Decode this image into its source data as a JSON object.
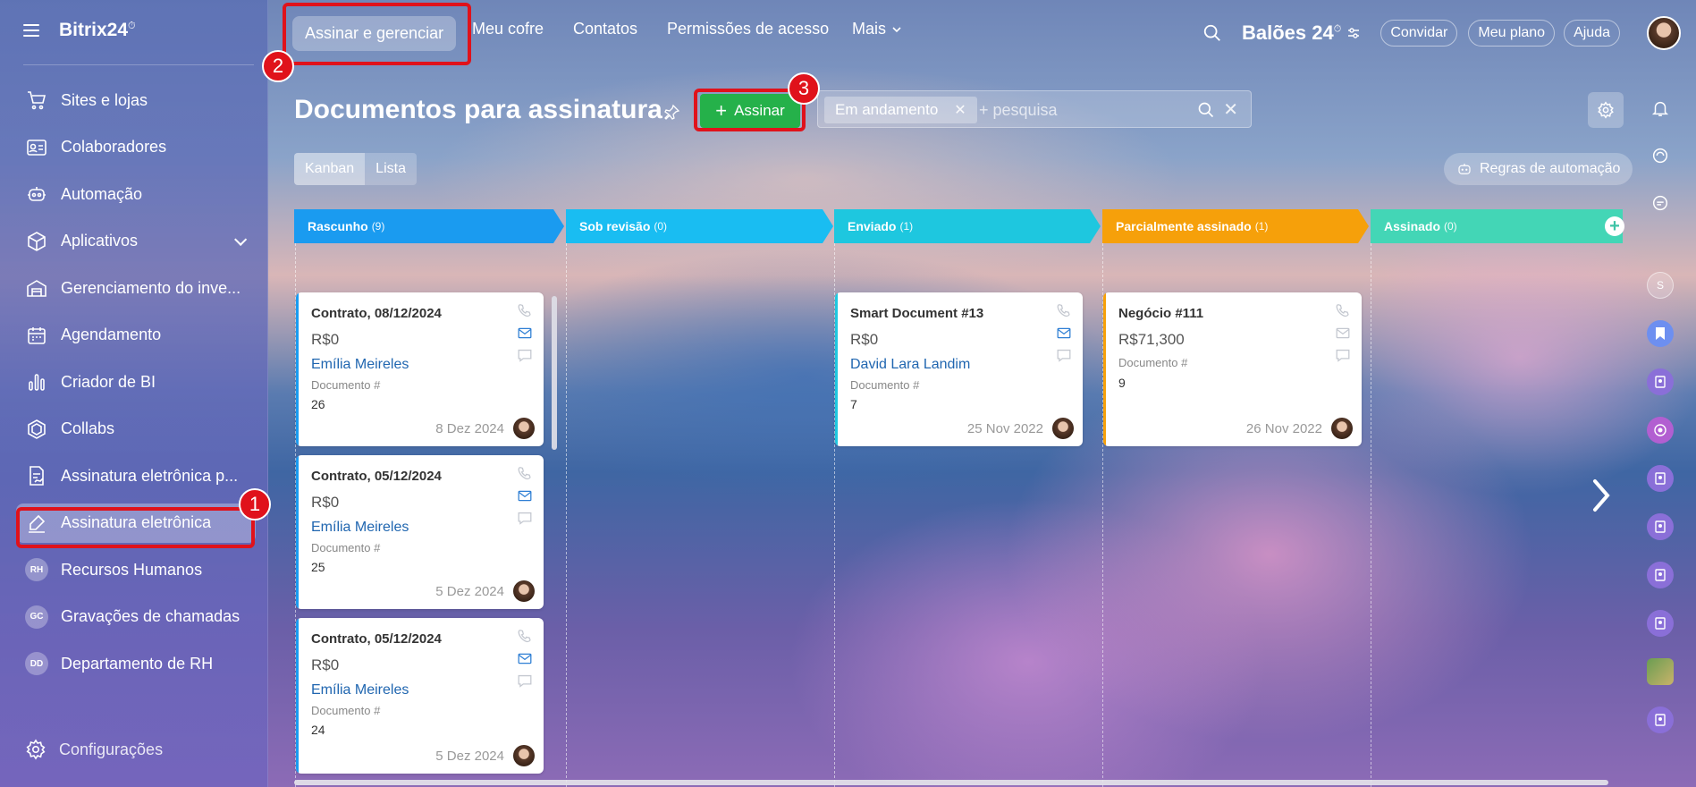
{
  "app": {
    "logo": "Bitrix24",
    "logo_mark": "⏱",
    "brand": "Balões 24",
    "brand_mark": "⏱"
  },
  "sidebar": {
    "items": [
      {
        "label": "Sites e lojas",
        "icon": "cart-icon"
      },
      {
        "label": "Colaboradores",
        "icon": "id-card-icon"
      },
      {
        "label": "Automação",
        "icon": "robot-icon"
      },
      {
        "label": "Aplicativos",
        "icon": "cube-icon"
      },
      {
        "label": "Gerenciamento do inve...",
        "icon": "warehouse-icon"
      },
      {
        "label": "Agendamento",
        "icon": "calendar-icon"
      },
      {
        "label": "Criador de BI",
        "icon": "chart-icon"
      },
      {
        "label": "Collabs",
        "icon": "hexagon-icon"
      },
      {
        "label": "Assinatura eletrônica p...",
        "icon": "document-sign-icon"
      },
      {
        "label": "Assinatura eletrônica",
        "icon": "pen-sign-icon"
      },
      {
        "label": "Recursos Humanos",
        "initials": "RH"
      },
      {
        "label": "Gravações de chamadas",
        "initials": "GC"
      },
      {
        "label": "Departamento de RH",
        "initials": "DD"
      }
    ],
    "settings_label": "Configurações"
  },
  "topbar": {
    "tabs": [
      "Assinar e gerenciar",
      "Meu cofre",
      "Contatos",
      "Permissões de acesso",
      "Mais"
    ],
    "invite": "Convidar",
    "plan": "Meu plano",
    "help": "Ajuda"
  },
  "page": {
    "title": "Documentos para assinatura",
    "sign_button": "Assinar",
    "filter_chip": "Em andamento",
    "search_placeholder": "+ pesquisa",
    "view_kanban": "Kanban",
    "view_list": "Lista",
    "automation_rules": "Regras de automação"
  },
  "annotations": [
    "1",
    "2",
    "3"
  ],
  "kanban": {
    "columns": [
      {
        "name": "Rascunho",
        "count": "(9)",
        "color": "#1a9bf0"
      },
      {
        "name": "Sob revisão",
        "count": "(0)",
        "color": "#19bdf2"
      },
      {
        "name": "Enviado",
        "count": "(1)",
        "color": "#1ec7df"
      },
      {
        "name": "Parcialmente assinado",
        "count": "(1)",
        "color": "#f6a00a"
      },
      {
        "name": "Assinado",
        "count": "(0)",
        "color": "#43d6b6"
      }
    ],
    "cards": [
      {
        "title": "Contrato, 08/12/2024",
        "price": "R$0",
        "person": "Emília Meireles",
        "doc_label": "Documento #",
        "doc_num": "26",
        "date": "8 Dez 2024"
      },
      {
        "title": "Contrato, 05/12/2024",
        "price": "R$0",
        "person": "Emília Meireles",
        "doc_label": "Documento #",
        "doc_num": "25",
        "date": "5 Dez 2024"
      },
      {
        "title": "Contrato, 05/12/2024",
        "price": "R$0",
        "person": "Emília Meireles",
        "doc_label": "Documento #",
        "doc_num": "24",
        "date": "5 Dez 2024"
      },
      {
        "title": "Smart Document #13",
        "price": "R$0",
        "person": "David Lara Landim",
        "doc_label": "Documento #",
        "doc_num": "7",
        "date": "25 Nov 2022"
      },
      {
        "title": "Negócio #111",
        "price": "R$71,300",
        "person": "",
        "doc_label": "Documento #",
        "doc_num": "9",
        "date": "26 Nov 2022"
      }
    ]
  },
  "colors": {
    "accent_green": "#25b14a",
    "annotation_red": "#e0121b",
    "link_blue": "#2066b0"
  }
}
